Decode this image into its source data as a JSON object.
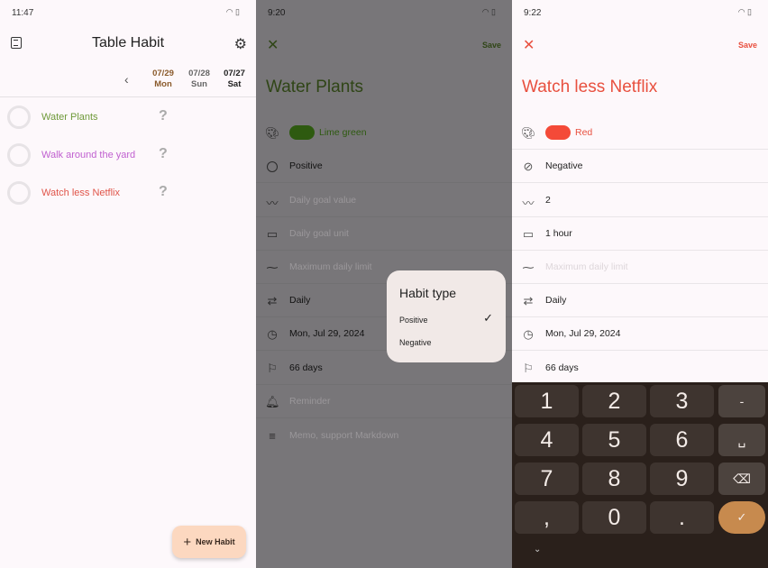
{
  "screen1": {
    "time": "11:47",
    "title": "Table Habit",
    "dates": [
      {
        "date": "07/29",
        "day": "Mon",
        "color": "#8a5a2b"
      },
      {
        "date": "07/28",
        "day": "Sun",
        "color": "#666666"
      },
      {
        "date": "07/27",
        "day": "Sat",
        "color": "#222222"
      }
    ],
    "habits": [
      {
        "name": "Water Plants",
        "color": "#6f9a3a",
        "status": "?"
      },
      {
        "name": "Walk around the yard",
        "color": "#c060d0",
        "status": "?"
      },
      {
        "name": "Watch less Netflix",
        "color": "#e0554a",
        "status": "?"
      }
    ],
    "fab_label": "New Habit"
  },
  "screen2": {
    "time": "9:20",
    "save": "Save",
    "habit_title": "Water Plants",
    "accent": "#3d5a1c",
    "fields": {
      "color": "Lime green",
      "type": "Positive",
      "goal_placeholder": "Daily goal value",
      "unit_placeholder": "Daily goal unit",
      "max_placeholder": "Maximum daily limit",
      "frequency": "Daily",
      "start": "Mon, Jul 29, 2024",
      "target": "66 days",
      "reminder_placeholder": "Reminder",
      "memo_placeholder": "Memo, support Markdown"
    },
    "dialog": {
      "title": "Habit type",
      "options": [
        "Positive",
        "Negative"
      ],
      "selected": "Positive"
    }
  },
  "screen3": {
    "time": "9:22",
    "save": "Save",
    "habit_title": "Watch less Netflix",
    "accent": "#e8503f",
    "fields": {
      "color": "Red",
      "type": "Negative",
      "goal": "2",
      "unit": "1 hour",
      "max_placeholder": "Maximum daily limit",
      "frequency": "Daily",
      "start": "Mon, Jul 29, 2024",
      "target": "66 days"
    },
    "keyboard": {
      "keys": [
        "1",
        "2",
        "3",
        "-",
        "4",
        "5",
        "6",
        "␣",
        "7",
        "8",
        "9",
        "⌫",
        ",",
        "0",
        ".",
        "✓"
      ]
    }
  }
}
